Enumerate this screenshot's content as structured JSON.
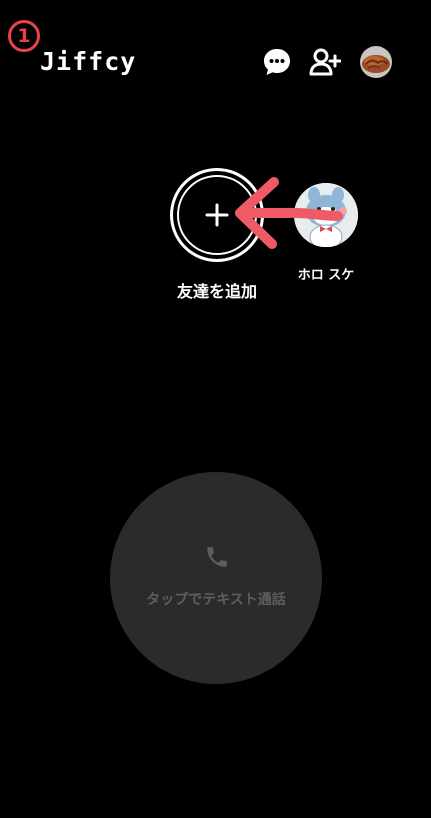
{
  "annotation": {
    "step_number": "1",
    "color": "#e8434a"
  },
  "header": {
    "app_title": "Jiffcy",
    "icons": [
      "chat-bubble-icon",
      "add-user-icon",
      "profile-avatar"
    ]
  },
  "friends": {
    "add_friend_label": "友達を追加",
    "add_icon": "plus-icon",
    "items": [
      {
        "name": "ホロ スケ",
        "avatar": "character-avatar"
      }
    ]
  },
  "call": {
    "label": "タップでテキスト通話",
    "icon": "phone-icon",
    "background": "#2b2b2b",
    "text_color": "#5e5e5e"
  }
}
